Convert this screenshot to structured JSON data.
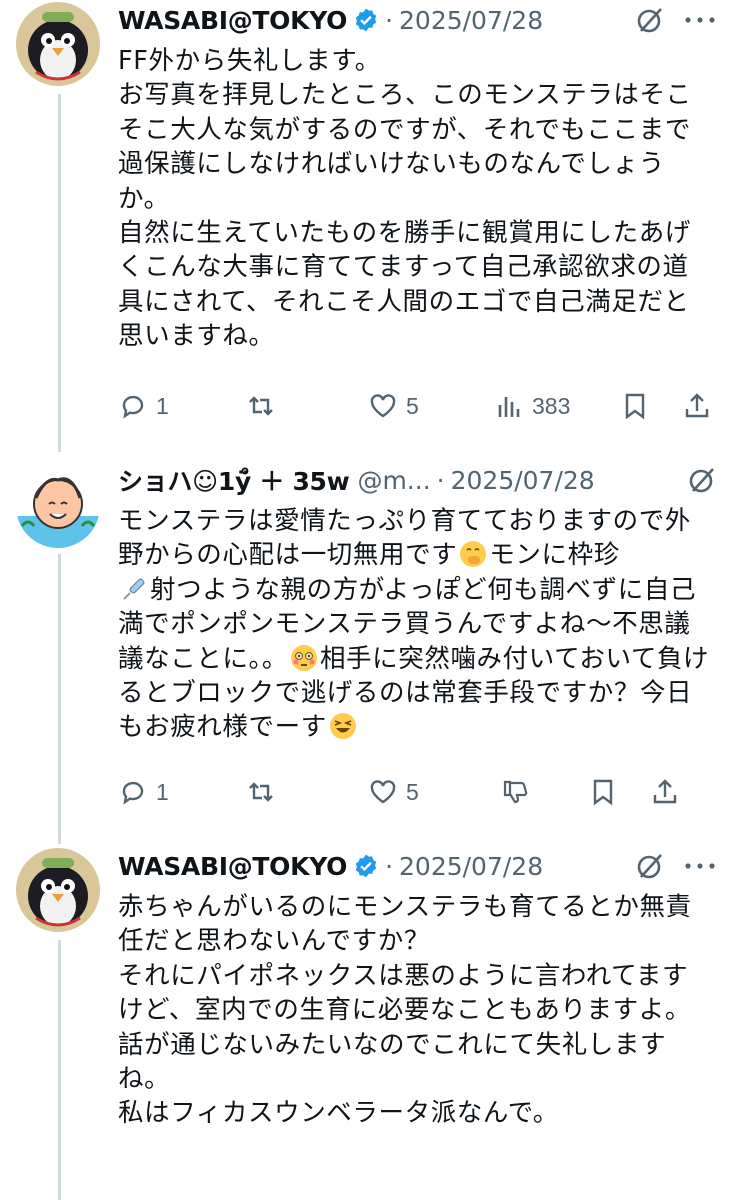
{
  "posts": [
    {
      "author_name": "WASABI@TOKYO",
      "verified": true,
      "handle": "",
      "date": "2025/07/28",
      "text": "FF外から失礼します。\nお写真を拝見したところ、このモンステラはそこそこ大人な気がするのですが、それでもここまで過保護にしなければいけないものなんでしょうか。\n自然に生えていたものを勝手に観賞用にしたあげくこんな大事に育ててますって自己承認欲求の道具にされて、それこそ人間のエゴで自己満足だと思いますね。",
      "replies": "1",
      "reposts": "",
      "likes": "5",
      "views": "383"
    },
    {
      "author_name": "ショハ☺1ÿ̊ ＋ 35w",
      "handle": "@m...",
      "date": "2025/07/28",
      "text_a": "モンステラは愛情たっぷり育てておりますので外野からの心配は一切無用です",
      "emoji_1": "hand-over-mouth-emoji",
      "text_b": "モンに枠珍",
      "emoji_2": "syringe-emoji",
      "text_c": "射つような親の方がよっぽど何も調べずに自己満でポンポンモンステラ買うんですよね〜不思議議なことに。。",
      "emoji_3": "flushed-face-emoji",
      "text_d": "相手に突然噛み付いておいて負けるとブロックで逃げるのは常套手段ですか？今日もお疲れ様でーす",
      "emoji_4": "grinning-squinting-face-emoji",
      "replies": "1",
      "reposts": "",
      "likes": "5"
    },
    {
      "author_name": "WASABI@TOKYO",
      "verified": true,
      "date": "2025/07/28",
      "text": "赤ちゃんがいるのにモンステラも育てるとか無責任だと思わないんですか？\nそれにパイポネックスは悪のように言われてますけど、室内での生育に必要なこともありますよ。\n話が通じないみたいなのでこれにて失礼しますね。\n私はフィカスウンベラータ派なんで。"
    }
  ],
  "colors": {
    "text": "#0f1419",
    "muted": "#536471",
    "verified": "#1d9bf0",
    "thread_line": "#cfd9de"
  },
  "separator": "·"
}
